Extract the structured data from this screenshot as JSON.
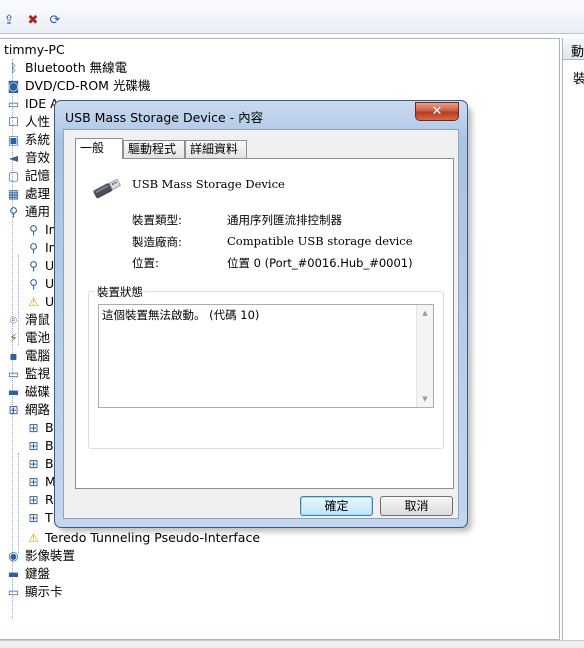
{
  "toolbar": {
    "buttons": [
      {
        "name": "update-driver",
        "glyph": "⇪"
      },
      {
        "name": "uninstall",
        "glyph": "✖"
      },
      {
        "name": "scan-hardware",
        "glyph": "⟳"
      }
    ]
  },
  "tree": {
    "root": "timmy-PC",
    "items": [
      {
        "label": "Bluetooth 無線電",
        "icon": "ᛒ"
      },
      {
        "label": "DVD/CD-ROM 光碟機",
        "icon": "◙"
      },
      {
        "label": "IDE A",
        "icon": "▭"
      },
      {
        "label": "人性",
        "icon": "☐"
      },
      {
        "label": "系統",
        "icon": "▣"
      },
      {
        "label": "音效",
        "icon": "◄"
      },
      {
        "label": "記憶",
        "icon": "▢"
      },
      {
        "label": "處理",
        "icon": "▦"
      },
      {
        "label": "通用",
        "icon": "⚲"
      },
      {
        "label": "In",
        "icon": "⚲"
      },
      {
        "label": "In",
        "icon": "⚲"
      },
      {
        "label": "U",
        "icon": "⚲"
      },
      {
        "label": "U",
        "icon": "⚲"
      },
      {
        "label": "U",
        "icon": "⚠"
      },
      {
        "label": "滑鼠",
        "icon": "⌾"
      },
      {
        "label": "電池",
        "icon": "⚡"
      },
      {
        "label": "電腦",
        "icon": "▪"
      },
      {
        "label": "監視",
        "icon": "▭"
      },
      {
        "label": "磁碟",
        "icon": "▬"
      },
      {
        "label": "網路",
        "icon": "⊞"
      },
      {
        "label": "B",
        "icon": "⊞"
      },
      {
        "label": "B",
        "icon": "⊞"
      },
      {
        "label": "B",
        "icon": "⊞"
      },
      {
        "label": "M",
        "icon": "⊞"
      },
      {
        "label": "R",
        "icon": "⊞"
      },
      {
        "label": "T",
        "icon": "⊞"
      },
      {
        "label": "Teredo Tunneling Pseudo-Interface",
        "icon": "⚠"
      },
      {
        "label": "影像裝置",
        "icon": "◉"
      },
      {
        "label": "鍵盤",
        "icon": "▬"
      },
      {
        "label": "顯示卡",
        "icon": "▭"
      }
    ]
  },
  "action_panel": {
    "header": "動",
    "item": "裝"
  },
  "dialog": {
    "title": "USB Mass Storage Device - 內容",
    "close_glyph": "✕",
    "tabs": [
      "一般",
      "驅動程式",
      "詳細資料"
    ],
    "device_name": "USB Mass Storage Device",
    "properties": [
      {
        "label": "裝置類型:",
        "value": "通用序列匯流排控制器"
      },
      {
        "label": "製造廠商:",
        "value": "Compatible USB storage device"
      },
      {
        "label": "位置:",
        "value": "位置 0 (Port_#0016.Hub_#0001)"
      }
    ],
    "status_group_label": "裝置狀態",
    "status_text": "這個裝置無法啟動。 (代碼 10)",
    "ok_label": "確定",
    "cancel_label": "取消"
  }
}
